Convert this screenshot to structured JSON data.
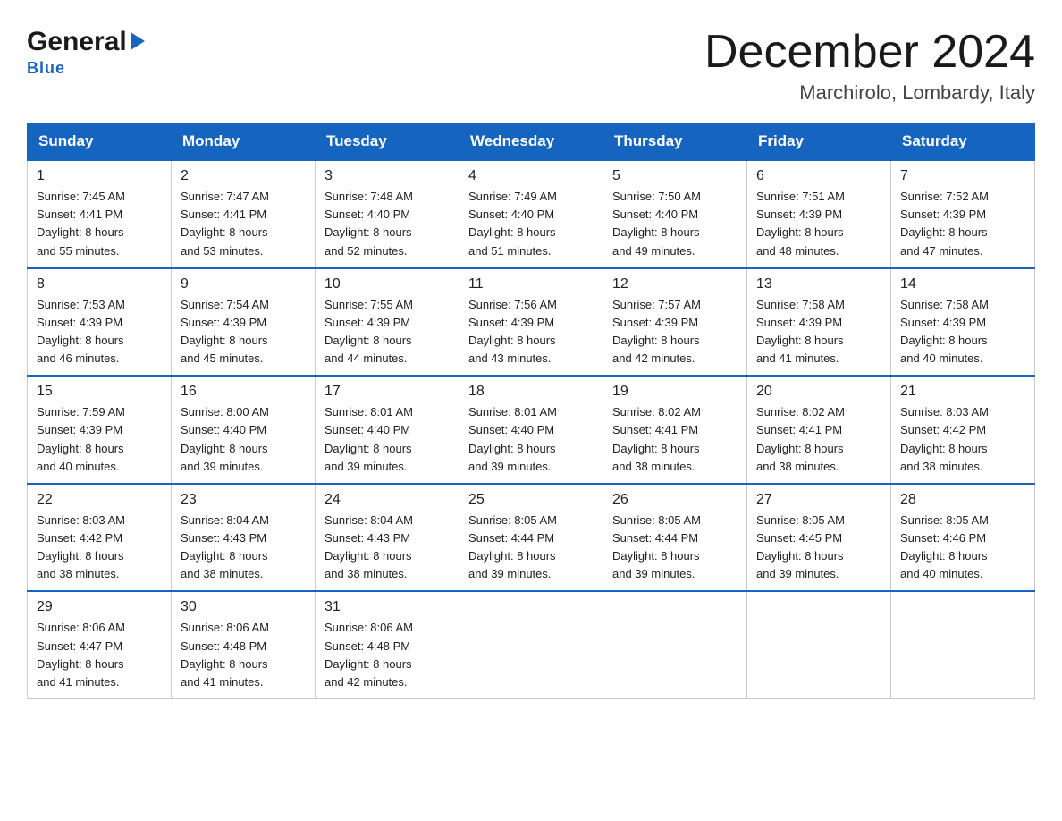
{
  "logo": {
    "general": "General",
    "triangle": "▶",
    "blue": "Blue"
  },
  "header": {
    "title": "December 2024",
    "location": "Marchirolo, Lombardy, Italy"
  },
  "days_of_week": [
    "Sunday",
    "Monday",
    "Tuesday",
    "Wednesday",
    "Thursday",
    "Friday",
    "Saturday"
  ],
  "weeks": [
    [
      {
        "day": "1",
        "sunrise": "7:45 AM",
        "sunset": "4:41 PM",
        "daylight": "8 hours and 55 minutes."
      },
      {
        "day": "2",
        "sunrise": "7:47 AM",
        "sunset": "4:41 PM",
        "daylight": "8 hours and 53 minutes."
      },
      {
        "day": "3",
        "sunrise": "7:48 AM",
        "sunset": "4:40 PM",
        "daylight": "8 hours and 52 minutes."
      },
      {
        "day": "4",
        "sunrise": "7:49 AM",
        "sunset": "4:40 PM",
        "daylight": "8 hours and 51 minutes."
      },
      {
        "day": "5",
        "sunrise": "7:50 AM",
        "sunset": "4:40 PM",
        "daylight": "8 hours and 49 minutes."
      },
      {
        "day": "6",
        "sunrise": "7:51 AM",
        "sunset": "4:39 PM",
        "daylight": "8 hours and 48 minutes."
      },
      {
        "day": "7",
        "sunrise": "7:52 AM",
        "sunset": "4:39 PM",
        "daylight": "8 hours and 47 minutes."
      }
    ],
    [
      {
        "day": "8",
        "sunrise": "7:53 AM",
        "sunset": "4:39 PM",
        "daylight": "8 hours and 46 minutes."
      },
      {
        "day": "9",
        "sunrise": "7:54 AM",
        "sunset": "4:39 PM",
        "daylight": "8 hours and 45 minutes."
      },
      {
        "day": "10",
        "sunrise": "7:55 AM",
        "sunset": "4:39 PM",
        "daylight": "8 hours and 44 minutes."
      },
      {
        "day": "11",
        "sunrise": "7:56 AM",
        "sunset": "4:39 PM",
        "daylight": "8 hours and 43 minutes."
      },
      {
        "day": "12",
        "sunrise": "7:57 AM",
        "sunset": "4:39 PM",
        "daylight": "8 hours and 42 minutes."
      },
      {
        "day": "13",
        "sunrise": "7:58 AM",
        "sunset": "4:39 PM",
        "daylight": "8 hours and 41 minutes."
      },
      {
        "day": "14",
        "sunrise": "7:58 AM",
        "sunset": "4:39 PM",
        "daylight": "8 hours and 40 minutes."
      }
    ],
    [
      {
        "day": "15",
        "sunrise": "7:59 AM",
        "sunset": "4:39 PM",
        "daylight": "8 hours and 40 minutes."
      },
      {
        "day": "16",
        "sunrise": "8:00 AM",
        "sunset": "4:40 PM",
        "daylight": "8 hours and 39 minutes."
      },
      {
        "day": "17",
        "sunrise": "8:01 AM",
        "sunset": "4:40 PM",
        "daylight": "8 hours and 39 minutes."
      },
      {
        "day": "18",
        "sunrise": "8:01 AM",
        "sunset": "4:40 PM",
        "daylight": "8 hours and 39 minutes."
      },
      {
        "day": "19",
        "sunrise": "8:02 AM",
        "sunset": "4:41 PM",
        "daylight": "8 hours and 38 minutes."
      },
      {
        "day": "20",
        "sunrise": "8:02 AM",
        "sunset": "4:41 PM",
        "daylight": "8 hours and 38 minutes."
      },
      {
        "day": "21",
        "sunrise": "8:03 AM",
        "sunset": "4:42 PM",
        "daylight": "8 hours and 38 minutes."
      }
    ],
    [
      {
        "day": "22",
        "sunrise": "8:03 AM",
        "sunset": "4:42 PM",
        "daylight": "8 hours and 38 minutes."
      },
      {
        "day": "23",
        "sunrise": "8:04 AM",
        "sunset": "4:43 PM",
        "daylight": "8 hours and 38 minutes."
      },
      {
        "day": "24",
        "sunrise": "8:04 AM",
        "sunset": "4:43 PM",
        "daylight": "8 hours and 38 minutes."
      },
      {
        "day": "25",
        "sunrise": "8:05 AM",
        "sunset": "4:44 PM",
        "daylight": "8 hours and 39 minutes."
      },
      {
        "day": "26",
        "sunrise": "8:05 AM",
        "sunset": "4:44 PM",
        "daylight": "8 hours and 39 minutes."
      },
      {
        "day": "27",
        "sunrise": "8:05 AM",
        "sunset": "4:45 PM",
        "daylight": "8 hours and 39 minutes."
      },
      {
        "day": "28",
        "sunrise": "8:05 AM",
        "sunset": "4:46 PM",
        "daylight": "8 hours and 40 minutes."
      }
    ],
    [
      {
        "day": "29",
        "sunrise": "8:06 AM",
        "sunset": "4:47 PM",
        "daylight": "8 hours and 41 minutes."
      },
      {
        "day": "30",
        "sunrise": "8:06 AM",
        "sunset": "4:48 PM",
        "daylight": "8 hours and 41 minutes."
      },
      {
        "day": "31",
        "sunrise": "8:06 AM",
        "sunset": "4:48 PM",
        "daylight": "8 hours and 42 minutes."
      },
      null,
      null,
      null,
      null
    ]
  ],
  "labels": {
    "sunrise": "Sunrise:",
    "sunset": "Sunset:",
    "daylight": "Daylight:"
  }
}
